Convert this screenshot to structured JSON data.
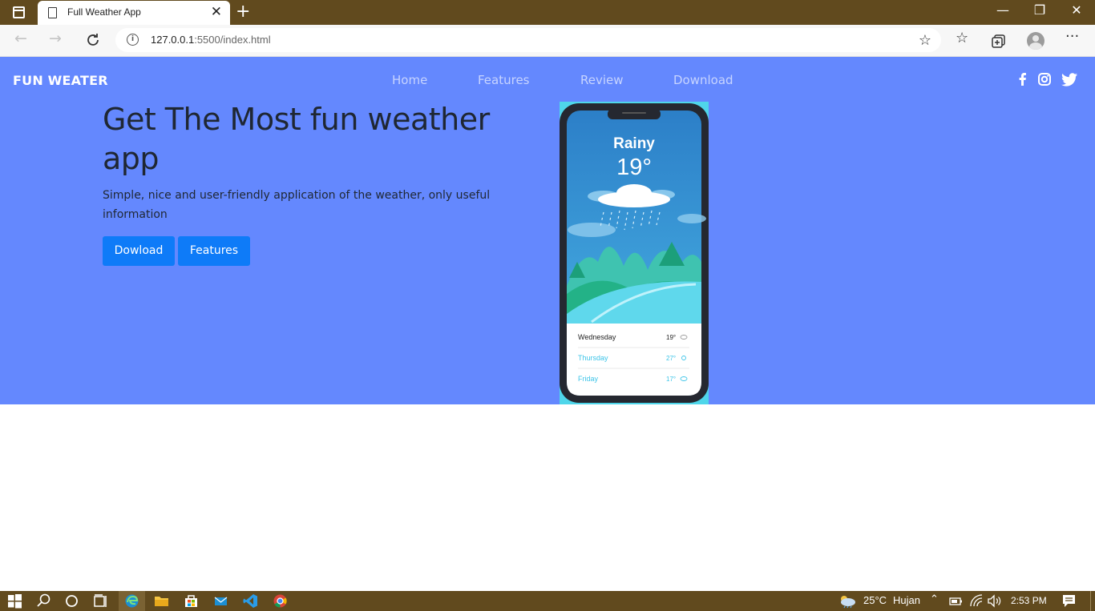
{
  "browser": {
    "tab_title": "Full Weather App",
    "tab_close": "✕",
    "new_tab": "+",
    "window_controls": {
      "minimize": "—",
      "restore": "❐",
      "close": "✕"
    },
    "back": "←",
    "forward": "→",
    "url_host": "127.0.0.1",
    "url_rest": ":5500/index.html",
    "icons": [
      "page-icon",
      "reload-icon",
      "info-icon",
      "favorite-add-icon",
      "favorites-icon",
      "collections-icon",
      "profile-icon",
      "more-icon"
    ]
  },
  "site": {
    "brand": "FUN WEATER",
    "nav": [
      "Home",
      "Features",
      "Review",
      "Download"
    ],
    "social_icons": [
      "facebook-icon",
      "instagram-icon",
      "twitter-icon"
    ],
    "hero": {
      "title": "Get The Most fun weather app",
      "subtitle": "Simple, nice and user-friendly application of the weather, only useful information",
      "buttons": [
        "Dowload",
        "Features"
      ]
    },
    "phone": {
      "condition": "Rainy",
      "temperature": "19°",
      "forecast": [
        {
          "day": "Wednesday",
          "temp": "19°"
        },
        {
          "day": "Thursday",
          "temp": "27°"
        },
        {
          "day": "Friday",
          "temp": "17°"
        }
      ]
    },
    "colors": {
      "hero_bg": "#6488fe",
      "button": "#0e7bf8",
      "chrome": "#614a1e"
    }
  },
  "taskbar": {
    "weather_temp": "25°C",
    "weather_text": "Hujan",
    "time": "2:53 PM"
  }
}
